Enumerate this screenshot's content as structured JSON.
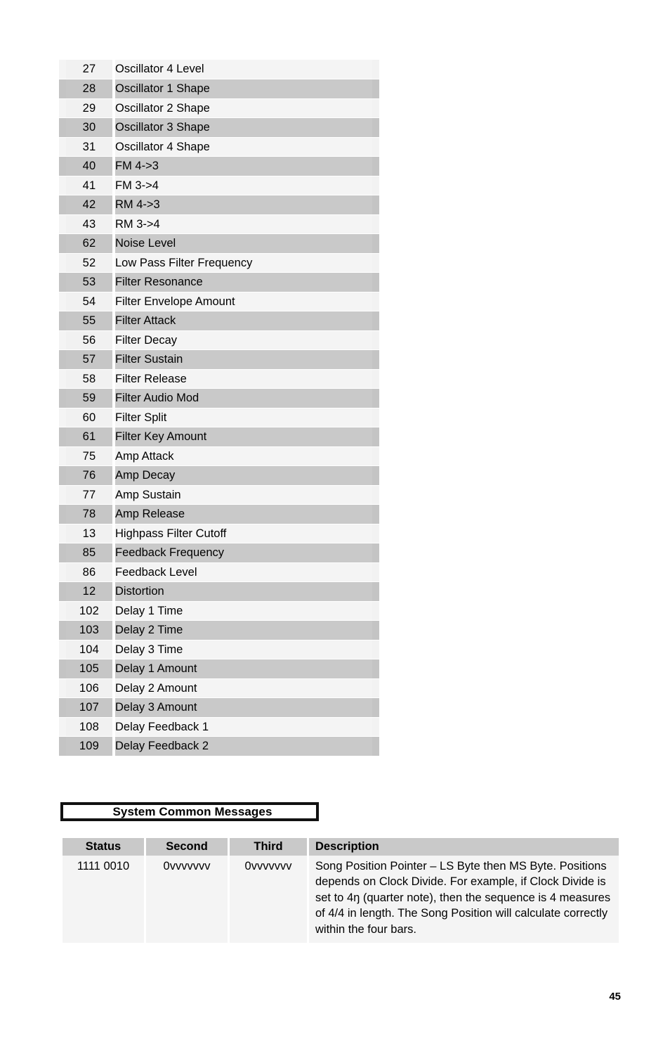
{
  "page": {
    "number": "45"
  },
  "cc_table": {
    "rows": [
      {
        "cc": "27",
        "name": "Oscillator 4 Level"
      },
      {
        "cc": "28",
        "name": "Oscillator 1 Shape"
      },
      {
        "cc": "29",
        "name": "Oscillator 2 Shape"
      },
      {
        "cc": "30",
        "name": "Oscillator 3 Shape"
      },
      {
        "cc": "31",
        "name": "Oscillator 4 Shape"
      },
      {
        "cc": "40",
        "name": "FM 4->3"
      },
      {
        "cc": "41",
        "name": "FM 3->4"
      },
      {
        "cc": "42",
        "name": "RM 4->3"
      },
      {
        "cc": "43",
        "name": "RM 3->4"
      },
      {
        "cc": "62",
        "name": "Noise Level"
      },
      {
        "cc": "52",
        "name": "Low Pass Filter Frequency"
      },
      {
        "cc": "53",
        "name": "Filter Resonance"
      },
      {
        "cc": "54",
        "name": "Filter Envelope Amount"
      },
      {
        "cc": "55",
        "name": "Filter Attack"
      },
      {
        "cc": "56",
        "name": "Filter Decay"
      },
      {
        "cc": "57",
        "name": "Filter Sustain"
      },
      {
        "cc": "58",
        "name": "Filter Release"
      },
      {
        "cc": "59",
        "name": "Filter Audio Mod"
      },
      {
        "cc": "60",
        "name": "Filter Split"
      },
      {
        "cc": "61",
        "name": "Filter Key Amount"
      },
      {
        "cc": "75",
        "name": "Amp Attack"
      },
      {
        "cc": "76",
        "name": "Amp Decay"
      },
      {
        "cc": "77",
        "name": "Amp Sustain"
      },
      {
        "cc": "78",
        "name": "Amp Release"
      },
      {
        "cc": "13",
        "name": "Highpass Filter Cutoff"
      },
      {
        "cc": "85",
        "name": "Feedback Frequency"
      },
      {
        "cc": "86",
        "name": "Feedback Level"
      },
      {
        "cc": "12",
        "name": "Distortion"
      },
      {
        "cc": "102",
        "name": "Delay 1 Time"
      },
      {
        "cc": "103",
        "name": "Delay 2 Time"
      },
      {
        "cc": "104",
        "name": "Delay 3 Time"
      },
      {
        "cc": "105",
        "name": "Delay 1 Amount"
      },
      {
        "cc": "106",
        "name": "Delay 2 Amount"
      },
      {
        "cc": "107",
        "name": "Delay 3 Amount"
      },
      {
        "cc": "108",
        "name": "Delay Feedback 1"
      },
      {
        "cc": "109",
        "name": "Delay Feedback 2"
      }
    ]
  },
  "section_heading": {
    "label": "System Common Messages"
  },
  "system_common_table": {
    "headers": {
      "status": "Status",
      "second": "Second",
      "third": "Third",
      "description": "Description"
    },
    "rows": [
      {
        "status": "1111 0010",
        "second": "0vvvvvvv",
        "third": "0vvvvvvv",
        "description": "Song Position Pointer – LS Byte then MS Byte. Positions depends on Clock Divide. For example, if Clock Divide is set to 4ŋ (quarter  note), then the sequence is 4 measures of 4/4 in length. The Song Position will calculate correctly within the four bars."
      }
    ]
  },
  "colors": {
    "row_light": "#f4f4f4",
    "row_dark": "#c9c9c9",
    "header_fill": "#c9c9c9",
    "box_border": "#111111",
    "text": "#000000"
  }
}
